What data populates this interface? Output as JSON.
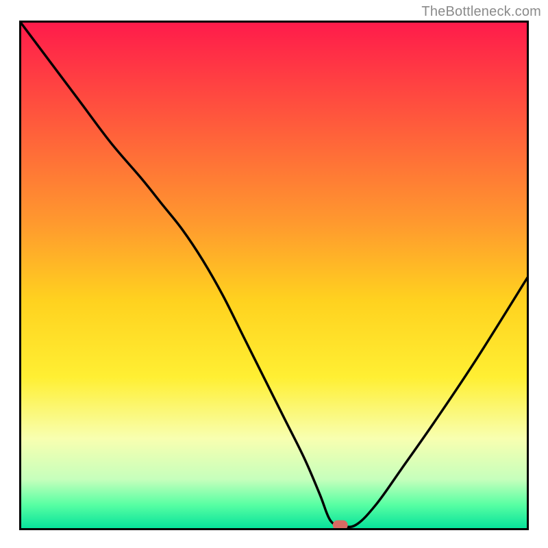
{
  "watermark": "TheBottleneck.com",
  "chart_data": {
    "type": "line",
    "title": "",
    "xlabel": "",
    "ylabel": "",
    "xlim": [
      0,
      100
    ],
    "ylim": [
      0,
      100
    ],
    "grid": false,
    "legend": false,
    "background_gradient": {
      "stops": [
        {
          "offset": 0.0,
          "color": "#ff1a4b"
        },
        {
          "offset": 0.2,
          "color": "#ff5a3c"
        },
        {
          "offset": 0.4,
          "color": "#ff9a2e"
        },
        {
          "offset": 0.55,
          "color": "#ffd21f"
        },
        {
          "offset": 0.7,
          "color": "#ffef33"
        },
        {
          "offset": 0.82,
          "color": "#f8ffb0"
        },
        {
          "offset": 0.9,
          "color": "#c6ffbc"
        },
        {
          "offset": 0.95,
          "color": "#58ffa3"
        },
        {
          "offset": 1.0,
          "color": "#00df9a"
        }
      ]
    },
    "marker": {
      "x": 63,
      "y": 1.0,
      "color": "#d86a63"
    },
    "series": [
      {
        "name": "curve",
        "x": [
          0,
          6,
          12,
          18,
          24,
          28,
          32,
          36,
          40,
          44,
          48,
          52,
          56,
          59,
          61,
          63,
          66,
          70,
          75,
          82,
          90,
          100
        ],
        "y": [
          100,
          92,
          84,
          76,
          69,
          64,
          59,
          53,
          46,
          38,
          30,
          22,
          14,
          7,
          2,
          1,
          1,
          5,
          12,
          22,
          34,
          50
        ]
      }
    ]
  }
}
